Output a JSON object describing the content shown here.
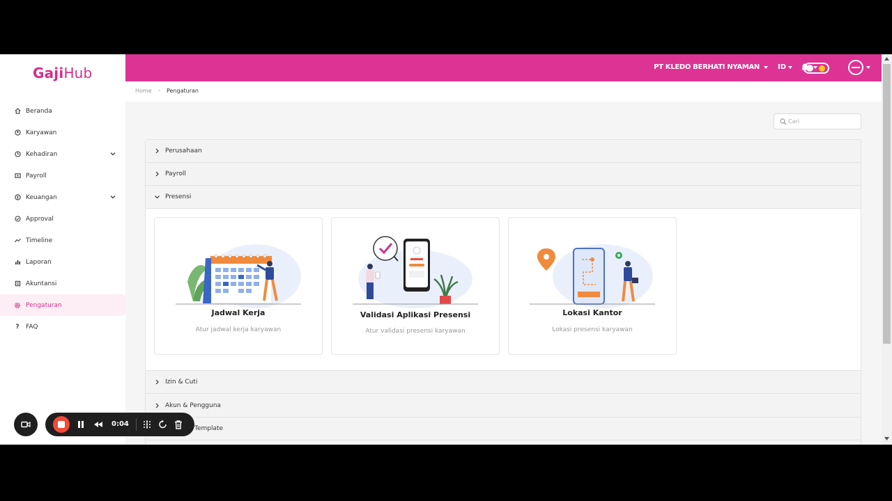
{
  "app": {
    "logo_bold": "Gaji",
    "logo_thin": "Hub",
    "brand_color": "#dd3394"
  },
  "header": {
    "company": "PT KLEDO BERHATI NYAMAN",
    "language": "ID"
  },
  "sidebar": {
    "items": [
      {
        "label": "Beranda",
        "icon": "home-icon"
      },
      {
        "label": "Karyawan",
        "icon": "users-icon"
      },
      {
        "label": "Kehadiran",
        "icon": "clock-icon",
        "expandable": true
      },
      {
        "label": "Payroll",
        "icon": "payroll-icon"
      },
      {
        "label": "Keuangan",
        "icon": "money-icon",
        "expandable": true
      },
      {
        "label": "Approval",
        "icon": "check-circle-icon"
      },
      {
        "label": "Timeline",
        "icon": "timeline-icon"
      },
      {
        "label": "Laporan",
        "icon": "chart-icon"
      },
      {
        "label": "Akuntansi",
        "icon": "book-icon"
      },
      {
        "label": "Pengaturan",
        "icon": "gear-icon",
        "active": true
      },
      {
        "label": "FAQ",
        "icon": "question-icon"
      }
    ]
  },
  "breadcrumb": {
    "home": "Home",
    "current": "Pengaturan"
  },
  "search": {
    "placeholder": "Cari"
  },
  "accordion": {
    "sections": [
      {
        "label": "Perusahaan",
        "expanded": false
      },
      {
        "label": "Payroll",
        "expanded": false
      },
      {
        "label": "Presensi",
        "expanded": true
      },
      {
        "label": "Izin & Cuti",
        "expanded": false
      },
      {
        "label": "Akun & Pengguna",
        "expanded": false
      },
      {
        "label": "Template",
        "expanded": false
      }
    ],
    "presensi_cards": [
      {
        "title": "Jadwal Kerja",
        "desc": "Atur jadwal kerja karyawan"
      },
      {
        "title": "Validasi Aplikasi Presensi",
        "desc": "Atur validasi presensi karyawan"
      },
      {
        "title": "Lokasi Kantor",
        "desc": "Lokasi presensi karyawan"
      }
    ]
  },
  "recorder": {
    "time": "0:04"
  }
}
